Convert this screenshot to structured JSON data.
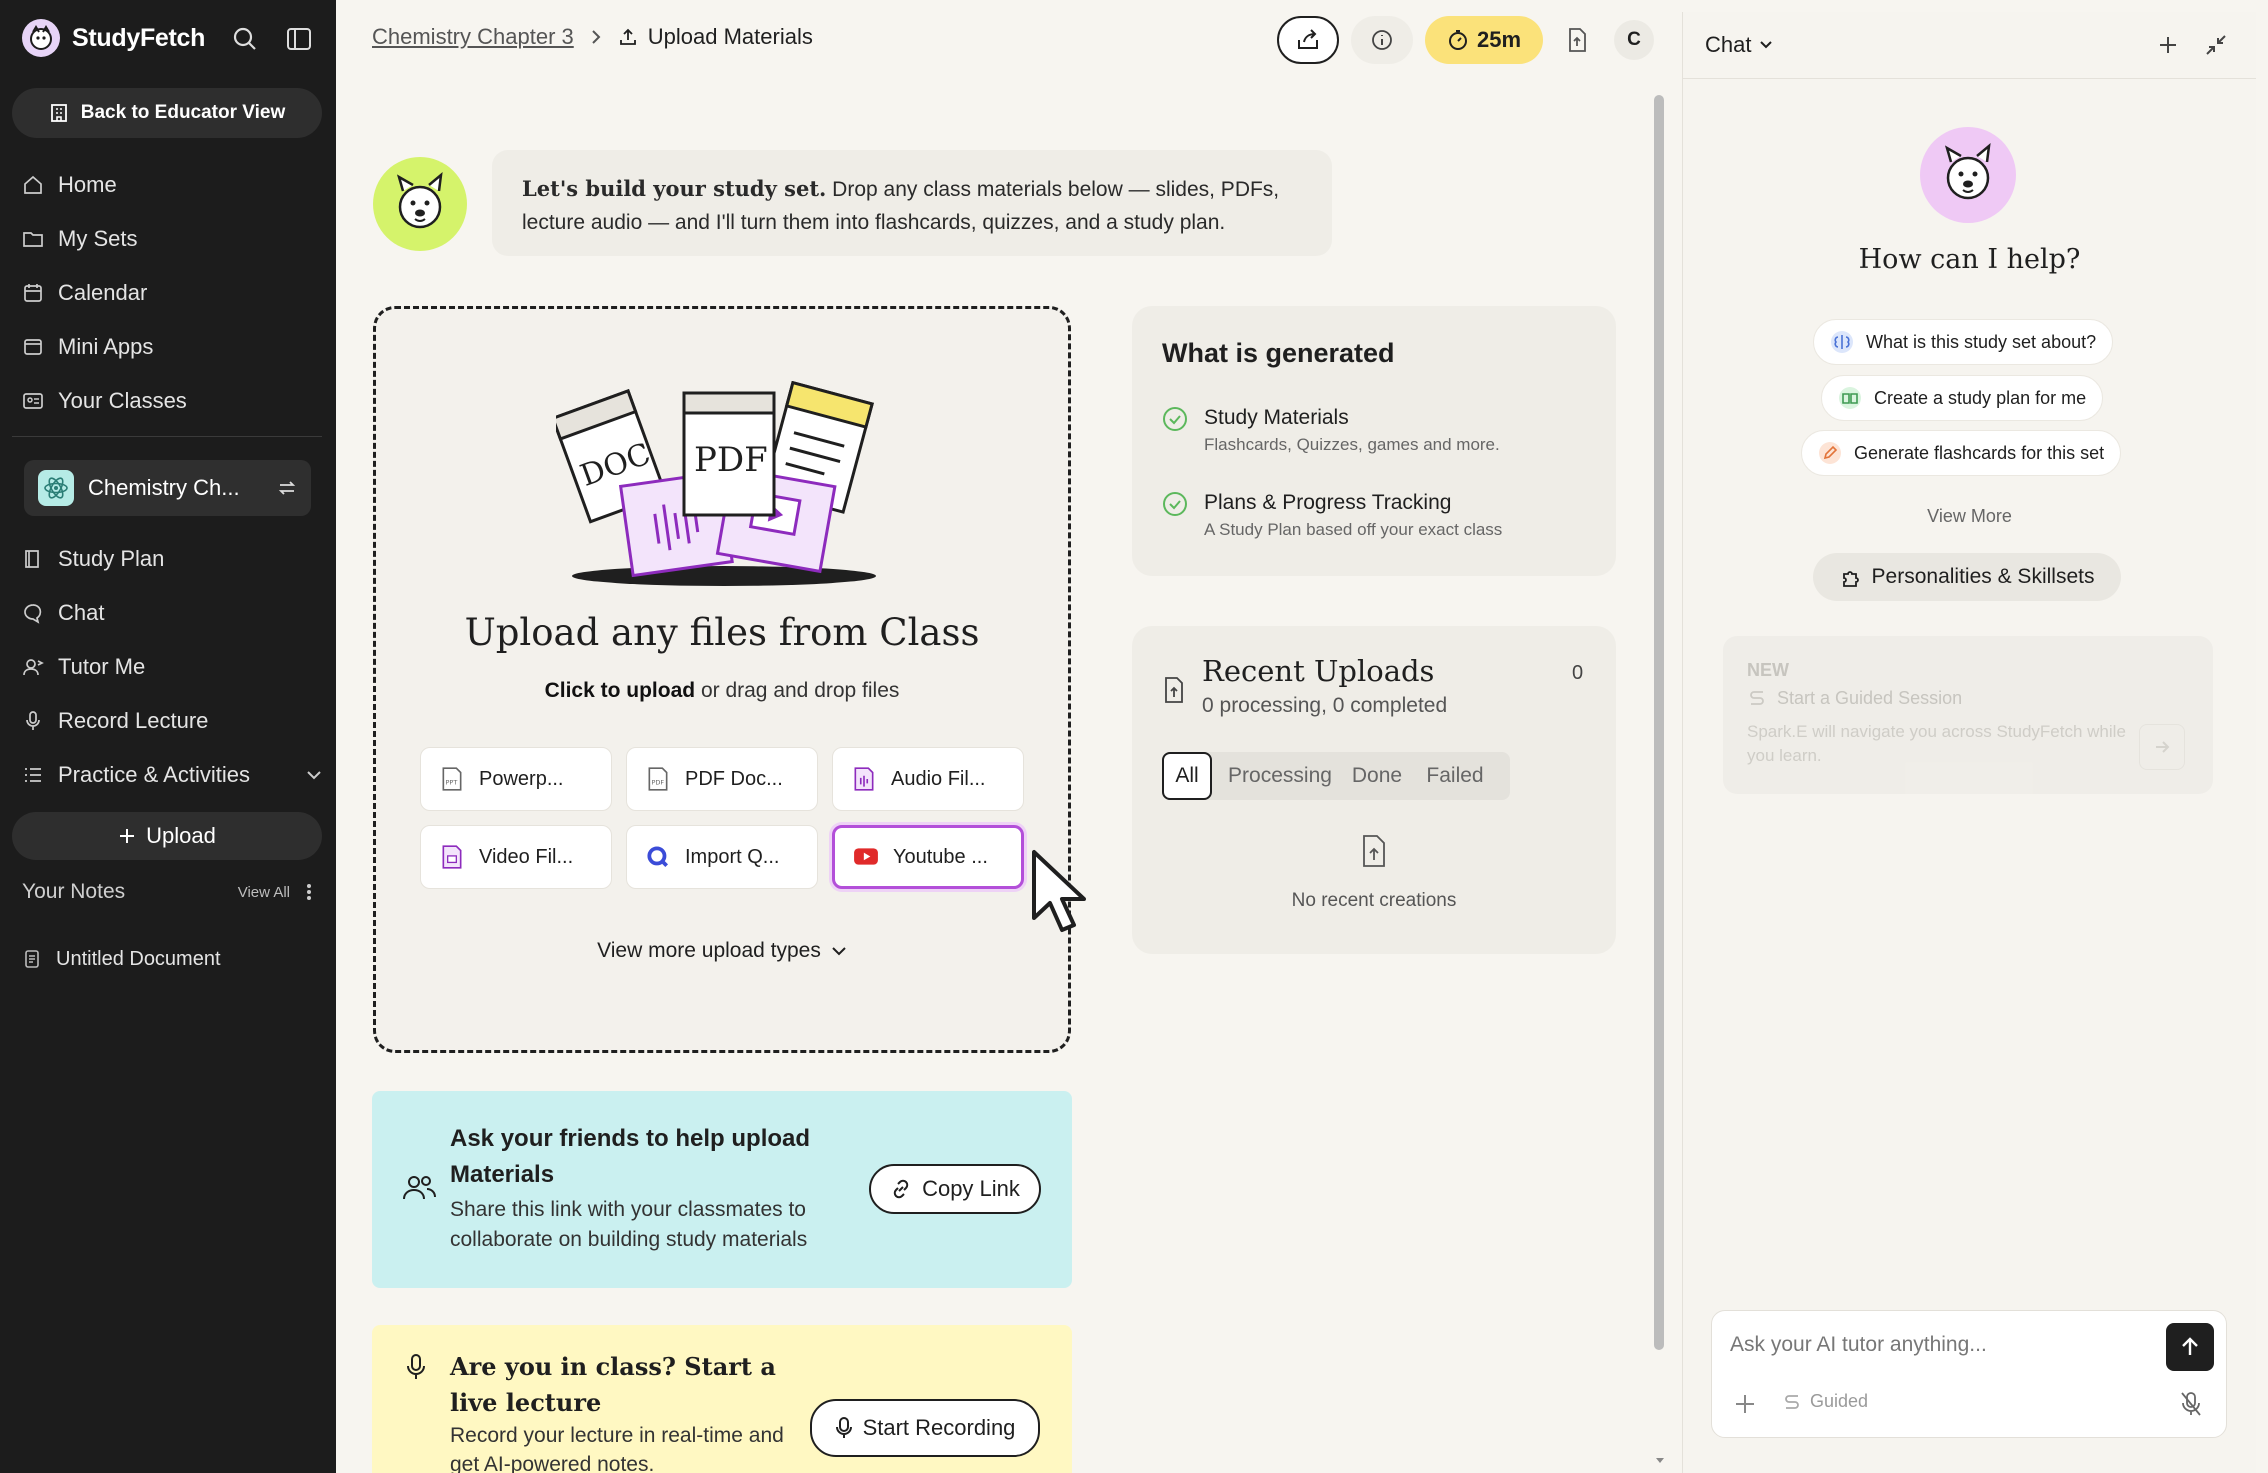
{
  "sidebar": {
    "brand": "StudyFetch",
    "educator_button": "Back to Educator View",
    "nav": [
      {
        "label": "Home",
        "icon": "home-icon"
      },
      {
        "label": "My Sets",
        "icon": "folder-icon"
      },
      {
        "label": "Calendar",
        "icon": "calendar-icon"
      },
      {
        "label": "Mini Apps",
        "icon": "app-window-icon"
      },
      {
        "label": "Your Classes",
        "icon": "classes-icon"
      }
    ],
    "current_set": "Chemistry Ch...",
    "set_nav": [
      {
        "label": "Study Plan",
        "icon": "book-icon"
      },
      {
        "label": "Chat",
        "icon": "chat-bubble-icon"
      },
      {
        "label": "Tutor Me",
        "icon": "tutor-icon"
      },
      {
        "label": "Record Lecture",
        "icon": "microphone-icon"
      },
      {
        "label": "Practice & Activities",
        "icon": "list-icon"
      }
    ],
    "upload_button": "Upload",
    "notes_header": "Your Notes",
    "notes_view_all": "View All",
    "notes": [
      "Untitled Document"
    ]
  },
  "header": {
    "breadcrumb_parent": "Chemistry Chapter 3",
    "breadcrumb_current": "Upload Materials",
    "timer": "25m",
    "avatar": "C"
  },
  "intro": {
    "bold": "Let's build your study set.",
    "text": " Drop any class materials below — slides, PDFs, lecture audio — and I'll turn them into flashcards, quizzes, and a study plan."
  },
  "dropzone": {
    "title": "Upload any files from Class",
    "sub_bold": "Click to upload",
    "sub_rest": " or drag and drop files",
    "illustration": {
      "doc": "DOC",
      "pdf": "PDF"
    },
    "tiles": [
      {
        "label": "Powerp...",
        "icon": "ppt-file-icon"
      },
      {
        "label": "PDF Doc...",
        "icon": "pdf-file-icon"
      },
      {
        "label": "Audio Fil...",
        "icon": "audio-file-icon"
      },
      {
        "label": "Video Fil...",
        "icon": "video-file-icon"
      },
      {
        "label": "Import Q...",
        "icon": "quizlet-icon"
      },
      {
        "label": "Youtube ...",
        "icon": "youtube-icon",
        "selected": true
      }
    ],
    "view_more": "View more upload types"
  },
  "generated": {
    "title": "What is generated",
    "items": [
      {
        "title": "Study Materials",
        "sub": "Flashcards, Quizzes, games and more."
      },
      {
        "title": "Plans & Progress Tracking",
        "sub": "A Study Plan based off your exact class"
      }
    ]
  },
  "recent": {
    "title": "Recent Uploads",
    "sub": "0 processing, 0 completed",
    "count": "0",
    "tabs": [
      "All",
      "Processing",
      "Done",
      "Failed"
    ],
    "active_tab": "All",
    "empty": "No recent creations"
  },
  "friends": {
    "title": "Ask your friends to help upload Materials",
    "text": "Share this link with your classmates to collaborate on building study materials",
    "button": "Copy Link"
  },
  "live": {
    "title": "Are you in class? Start a live lecture",
    "text": "Record your lecture in real-time and get AI-powered notes.",
    "button": "Start Recording"
  },
  "chat": {
    "title": "Chat",
    "heading": "How can I help?",
    "suggestions": [
      {
        "label": "What is this study set about?",
        "icon": "brain-icon"
      },
      {
        "label": "Create a study plan for me",
        "icon": "open-book-icon"
      },
      {
        "label": "Generate flashcards for this set",
        "icon": "pencil-icon"
      }
    ],
    "view_more": "View More",
    "skills": "Personalities & Skillsets",
    "guided": {
      "tag": "NEW",
      "title": "Start a Guided Session",
      "text": "Spark.E will navigate you across StudyFetch while you learn."
    },
    "input_placeholder": "Ask your AI tutor anything...",
    "guided_toggle": "Guided"
  },
  "colors": {
    "accent_purple": "#b34fd9",
    "timer_yellow": "#fbe27a",
    "friends_bg": "#caf0f0",
    "live_bg": "#fff8c2",
    "check_green": "#5cb85c"
  }
}
